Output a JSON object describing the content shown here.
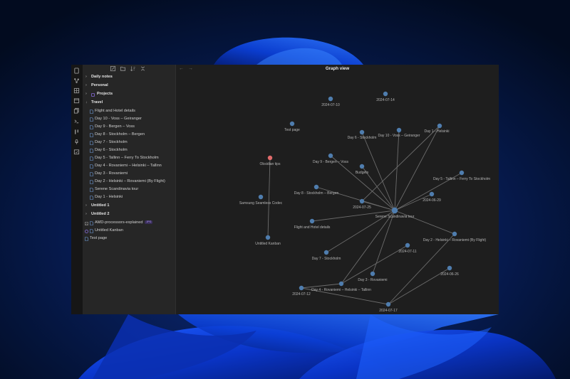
{
  "colors": {
    "node": "#4f7dae",
    "node_highlight": "#e06b6b",
    "edge": "#6c6c6c",
    "label": "#b5b5b5",
    "accent": "#9b7bff"
  },
  "ribbon": {
    "icons": [
      "files-icon",
      "graph-icon",
      "dashboard-icon",
      "calendar-icon",
      "copy-icon",
      "terminal-icon",
      "kanban-icon",
      "microphone-icon",
      "calendar-check-icon"
    ]
  },
  "sidebar": {
    "actions": [
      "new-note-icon",
      "new-folder-icon",
      "sort-icon",
      "collapse-all-icon"
    ],
    "tree": [
      {
        "label": "Daily notes",
        "type": "folder",
        "expanded": false
      },
      {
        "label": "Personal",
        "type": "folder",
        "expanded": false
      },
      {
        "label": "Projects",
        "type": "folder",
        "expanded": false,
        "icon": "projects-icon"
      },
      {
        "label": "Travel",
        "type": "folder",
        "expanded": true
      },
      {
        "label": "Flight and Hotel details",
        "type": "file",
        "indent": 1
      },
      {
        "label": "Day 10 - Voss – Geiranger",
        "type": "file",
        "indent": 1
      },
      {
        "label": "Day 9 - Bergen – Voss",
        "type": "file",
        "indent": 1
      },
      {
        "label": "Day 8 - Stockholm – Bergen",
        "type": "file",
        "indent": 1
      },
      {
        "label": "Day 7 - Stockholm",
        "type": "file",
        "indent": 1
      },
      {
        "label": "Day 6 - Stockholm",
        "type": "file",
        "indent": 1
      },
      {
        "label": "Day 5 - Tallinn – Ferry To Stockholm",
        "type": "file",
        "indent": 1
      },
      {
        "label": "Day 4 - Rovaniemi – Helsinki – Tallinn",
        "type": "file",
        "indent": 1
      },
      {
        "label": "Day 3 - Rovaniemi",
        "type": "file",
        "indent": 1
      },
      {
        "label": "Day 2 - Helsinki – Rovaniemi (By Flight)",
        "type": "file",
        "indent": 1
      },
      {
        "label": "Serene Scandinavia tour",
        "type": "file",
        "indent": 1
      },
      {
        "label": "Day 1 - Helsinki",
        "type": "file",
        "indent": 1
      },
      {
        "label": "Untitled 1",
        "type": "folder",
        "expanded": false
      },
      {
        "label": "Untitled 2",
        "type": "folder",
        "expanded": false
      },
      {
        "label": "AMD-processors-explained",
        "type": "file",
        "indent": 0,
        "badge": "JPG",
        "icon": "image-icon"
      },
      {
        "label": "Untitled Kanban",
        "type": "file",
        "indent": 0,
        "icon": "kanban-icon"
      },
      {
        "label": "Test page",
        "type": "file",
        "indent": 0
      }
    ]
  },
  "graph": {
    "title": "Graph view",
    "nodes": [
      {
        "id": "n0",
        "label": "2024-07-10"
      },
      {
        "id": "n1",
        "label": "2024-07-14"
      },
      {
        "id": "n2",
        "label": "Test page"
      },
      {
        "id": "n3",
        "label": "Day 6 - Stockholm"
      },
      {
        "id": "n4",
        "label": "Day 10 - Voss – Geiranger"
      },
      {
        "id": "n5",
        "label": "Day 1 - Helsinki"
      },
      {
        "id": "n6",
        "label": "Obsidian tips",
        "highlight": true
      },
      {
        "id": "n7",
        "label": "Day 9 - Bergen – Voss"
      },
      {
        "id": "n8",
        "label": "Budgets"
      },
      {
        "id": "n9",
        "label": "Day 5 - Tallinn – Ferry To Stockholm"
      },
      {
        "id": "n10",
        "label": "Day 8 - Stockholm – Bergen"
      },
      {
        "id": "n11",
        "label": "2024-06-29"
      },
      {
        "id": "n12",
        "label": "Samsung Seamless Codec"
      },
      {
        "id": "n13",
        "label": "2024-07-25"
      },
      {
        "id": "n14",
        "label": "Serene Scandinavia tour",
        "hub": true
      },
      {
        "id": "n15",
        "label": "Flight and Hotel details"
      },
      {
        "id": "n16",
        "label": "Day 2 - Helsinki – Rovaniemi (By Flight)"
      },
      {
        "id": "n17",
        "label": "Untitled Kanban"
      },
      {
        "id": "n18",
        "label": "2024-07-11"
      },
      {
        "id": "n19",
        "label": "Day 7 - Stockholm"
      },
      {
        "id": "n20",
        "label": "2024-06-26"
      },
      {
        "id": "n21",
        "label": "Day 3 - Rovaniemi"
      },
      {
        "id": "n22",
        "label": "Day 4 - Rovaniemi – Helsinki – Tallinn"
      },
      {
        "id": "n23",
        "label": "2024-07-12"
      },
      {
        "id": "n24",
        "label": "2024-07-17"
      }
    ],
    "edges": [
      [
        "n14",
        "n3"
      ],
      [
        "n14",
        "n4"
      ],
      [
        "n14",
        "n5"
      ],
      [
        "n14",
        "n7"
      ],
      [
        "n14",
        "n8"
      ],
      [
        "n14",
        "n9"
      ],
      [
        "n14",
        "n10"
      ],
      [
        "n14",
        "n11"
      ],
      [
        "n14",
        "n13"
      ],
      [
        "n14",
        "n15"
      ],
      [
        "n14",
        "n16"
      ],
      [
        "n14",
        "n19"
      ],
      [
        "n14",
        "n21"
      ],
      [
        "n14",
        "n22"
      ],
      [
        "n6",
        "n17"
      ],
      [
        "n16",
        "n24"
      ],
      [
        "n23",
        "n24"
      ],
      [
        "n22",
        "n18"
      ],
      [
        "n22",
        "n23"
      ],
      [
        "n20",
        "n24"
      ],
      [
        "n5",
        "n13"
      ]
    ]
  }
}
